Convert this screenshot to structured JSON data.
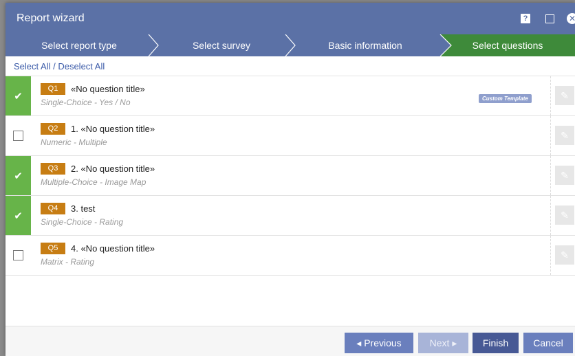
{
  "window": {
    "title": "Report wizard",
    "help_glyph": "?",
    "close_glyph": "✕"
  },
  "steps": [
    {
      "label": "Select report type",
      "active": false
    },
    {
      "label": "Select survey",
      "active": false
    },
    {
      "label": "Basic information",
      "active": false
    },
    {
      "label": "Select questions",
      "active": true
    }
  ],
  "select_links": {
    "select_all": "Select All",
    "separator": " / ",
    "deselect_all": "Deselect All"
  },
  "questions": [
    {
      "badge": "Q1",
      "title": "«No question title»",
      "subtitle": "Single-Choice - Yes / No",
      "checked": true,
      "template_badge": "Custom Template"
    },
    {
      "badge": "Q2",
      "title": "1.  «No question title»",
      "subtitle": "Numeric - Multiple",
      "checked": false
    },
    {
      "badge": "Q3",
      "title": "2.  «No question title»",
      "subtitle": "Multiple-Choice - Image Map",
      "checked": true
    },
    {
      "badge": "Q4",
      "title": "3.  test",
      "subtitle": "Single-Choice - Rating",
      "checked": true
    },
    {
      "badge": "Q5",
      "title": "4.  «No question title»",
      "subtitle": "Matrix - Rating",
      "checked": false
    }
  ],
  "icons": {
    "check": "✔",
    "edit": "✎"
  },
  "footer": {
    "previous_label": "◂ Previous",
    "next_label": "Next ▸",
    "finish_label": "Finish",
    "cancel_label": "Cancel"
  },
  "colors": {
    "header": "#5b71a6",
    "active_step": "#3e8a3a",
    "checked": "#67b449",
    "question_badge": "#c77d13",
    "template_badge": "#8f9fcd",
    "button_primary": "#6a7fbd",
    "button_disabled": "#a8b4d8",
    "button_dark": "#475995"
  }
}
